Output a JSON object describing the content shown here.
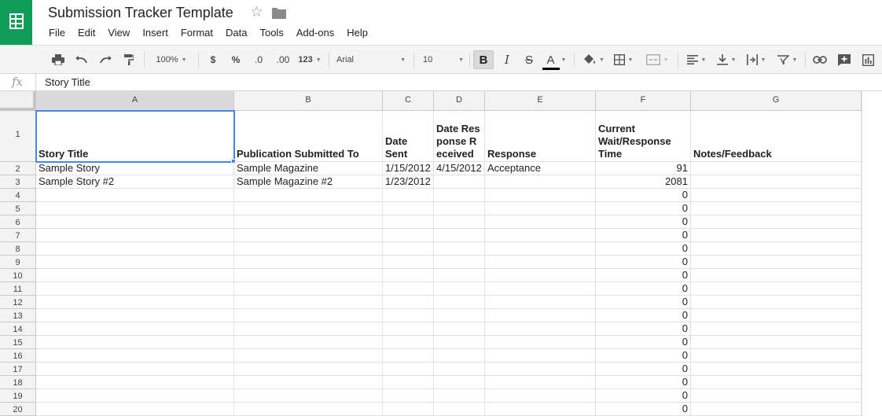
{
  "document": {
    "title": "Submission Tracker Template",
    "app_icon": "sheets-logo-icon",
    "star_icon": "star-outline-icon",
    "folder_icon": "folder-icon"
  },
  "menu": [
    "File",
    "Edit",
    "View",
    "Insert",
    "Format",
    "Data",
    "Tools",
    "Add-ons",
    "Help"
  ],
  "toolbar": {
    "zoom": "100%",
    "currency": "$",
    "percent": "%",
    "decrease_decimal": ".0",
    "increase_decimal": ".00",
    "more_formats": "123",
    "font_family": "Arial",
    "font_size": "10",
    "bold": "B",
    "italic": "I",
    "strikethrough": "S",
    "text_color": "A",
    "text_color_value": "#000000",
    "icons": [
      "print-icon",
      "undo-icon",
      "redo-icon",
      "paint-format-icon",
      "fill-color-icon",
      "borders-icon",
      "merge-cells-icon",
      "align-left-icon",
      "valign-bottom-icon",
      "text-wrap-icon",
      "text-rotate-icon",
      "link-icon",
      "insert-comment-icon",
      "insert-chart-icon"
    ]
  },
  "formula_bar": {
    "fx_label": "fx",
    "value": "Story Title"
  },
  "sheet": {
    "columns": [
      "A",
      "B",
      "C",
      "D",
      "E",
      "F",
      "G"
    ],
    "selected_cell": "A1",
    "header_row": {
      "row_number": "1",
      "cells": [
        "Story Title",
        "Publication Submitted To",
        "Date Sent",
        "Date Response Received",
        "Response",
        "Current Wait/Response Time",
        "Notes/Feedback"
      ]
    },
    "rows": [
      {
        "num": "2",
        "cells": [
          "Sample Story",
          "Sample Magazine",
          "1/15/2012",
          "4/15/2012",
          "Acceptance",
          "91",
          ""
        ]
      },
      {
        "num": "3",
        "cells": [
          "Sample Story #2",
          "Sample Magazine #2",
          "1/23/2012",
          "",
          "",
          "2081",
          ""
        ]
      },
      {
        "num": "4",
        "cells": [
          "",
          "",
          "",
          "",
          "",
          "0",
          ""
        ]
      },
      {
        "num": "5",
        "cells": [
          "",
          "",
          "",
          "",
          "",
          "0",
          ""
        ]
      },
      {
        "num": "6",
        "cells": [
          "",
          "",
          "",
          "",
          "",
          "0",
          ""
        ]
      },
      {
        "num": "7",
        "cells": [
          "",
          "",
          "",
          "",
          "",
          "0",
          ""
        ]
      },
      {
        "num": "8",
        "cells": [
          "",
          "",
          "",
          "",
          "",
          "0",
          ""
        ]
      },
      {
        "num": "9",
        "cells": [
          "",
          "",
          "",
          "",
          "",
          "0",
          ""
        ]
      },
      {
        "num": "10",
        "cells": [
          "",
          "",
          "",
          "",
          "",
          "0",
          ""
        ]
      },
      {
        "num": "11",
        "cells": [
          "",
          "",
          "",
          "",
          "",
          "0",
          ""
        ]
      },
      {
        "num": "12",
        "cells": [
          "",
          "",
          "",
          "",
          "",
          "0",
          ""
        ]
      },
      {
        "num": "13",
        "cells": [
          "",
          "",
          "",
          "",
          "",
          "0",
          ""
        ]
      },
      {
        "num": "14",
        "cells": [
          "",
          "",
          "",
          "",
          "",
          "0",
          ""
        ]
      },
      {
        "num": "15",
        "cells": [
          "",
          "",
          "",
          "",
          "",
          "0",
          ""
        ]
      },
      {
        "num": "16",
        "cells": [
          "",
          "",
          "",
          "",
          "",
          "0",
          ""
        ]
      },
      {
        "num": "17",
        "cells": [
          "",
          "",
          "",
          "",
          "",
          "0",
          ""
        ]
      },
      {
        "num": "18",
        "cells": [
          "",
          "",
          "",
          "",
          "",
          "0",
          ""
        ]
      },
      {
        "num": "19",
        "cells": [
          "",
          "",
          "",
          "",
          "",
          "0",
          ""
        ]
      },
      {
        "num": "20",
        "cells": [
          "",
          "",
          "",
          "",
          "",
          "0",
          ""
        ]
      }
    ]
  },
  "colors": {
    "brand": "#0f9d58",
    "selection": "#4285f4"
  }
}
